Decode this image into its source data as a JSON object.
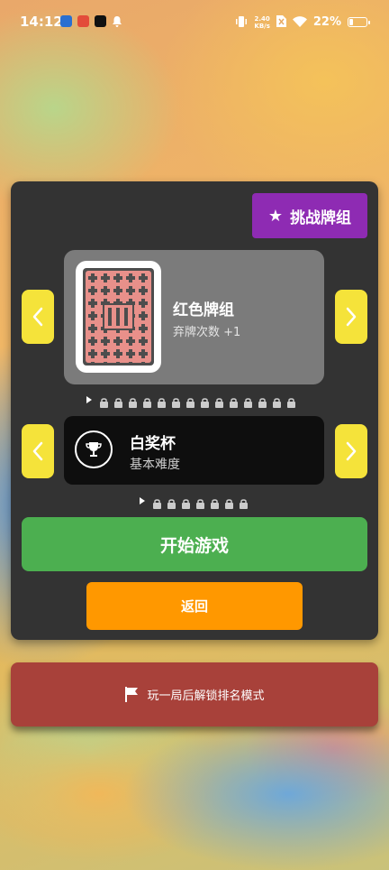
{
  "status_bar": {
    "time": "14:12",
    "net_speed_value": "2.40",
    "net_speed_unit": "KB/s",
    "battery_percent": "22%",
    "battery_level": 0.22
  },
  "challenge_button": {
    "icon": "star-icon",
    "label": "挑战牌组"
  },
  "deck": {
    "name": "红色牌组",
    "description": "弃牌次数 +1",
    "card_back_color": "#e8908a",
    "progress": {
      "current_index": 0,
      "locked_count": 14
    }
  },
  "stake": {
    "icon": "trophy-icon",
    "name": "白奖杯",
    "description": "基本难度",
    "progress": {
      "current_index": 0,
      "locked_count": 7
    }
  },
  "start_button": {
    "label": "开始游戏"
  },
  "back_button": {
    "label": "返回"
  },
  "ranked_banner": {
    "icon": "flag-icon",
    "text": "玩一局后解锁排名模式"
  },
  "colors": {
    "panel": "#333333",
    "challenge": "#8e2bb3",
    "arrow": "#f5e33a",
    "start": "#4caf50",
    "back": "#ff9800",
    "banner": "#a8413a"
  }
}
